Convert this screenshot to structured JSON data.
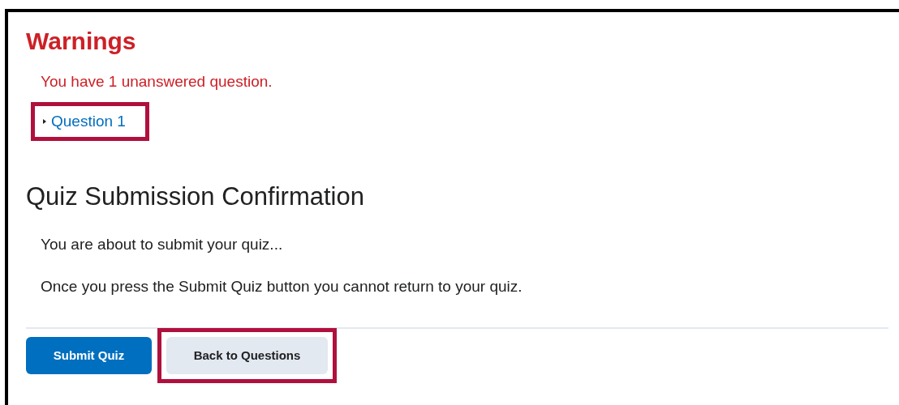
{
  "warnings": {
    "title": "Warnings",
    "message": "You have 1 unanswered question.",
    "questions": [
      {
        "label": "Question 1",
        "highlighted": true
      }
    ]
  },
  "confirmation": {
    "title": "Quiz Submission Confirmation",
    "paragraphs": [
      "You are about to submit your quiz...",
      "Once you press the Submit Quiz button you cannot return to your quiz."
    ]
  },
  "buttons": [
    {
      "label": "Submit Quiz",
      "kind": "primary",
      "highlighted": false
    },
    {
      "label": "Back to Questions",
      "kind": "secondary",
      "highlighted": true
    }
  ]
}
